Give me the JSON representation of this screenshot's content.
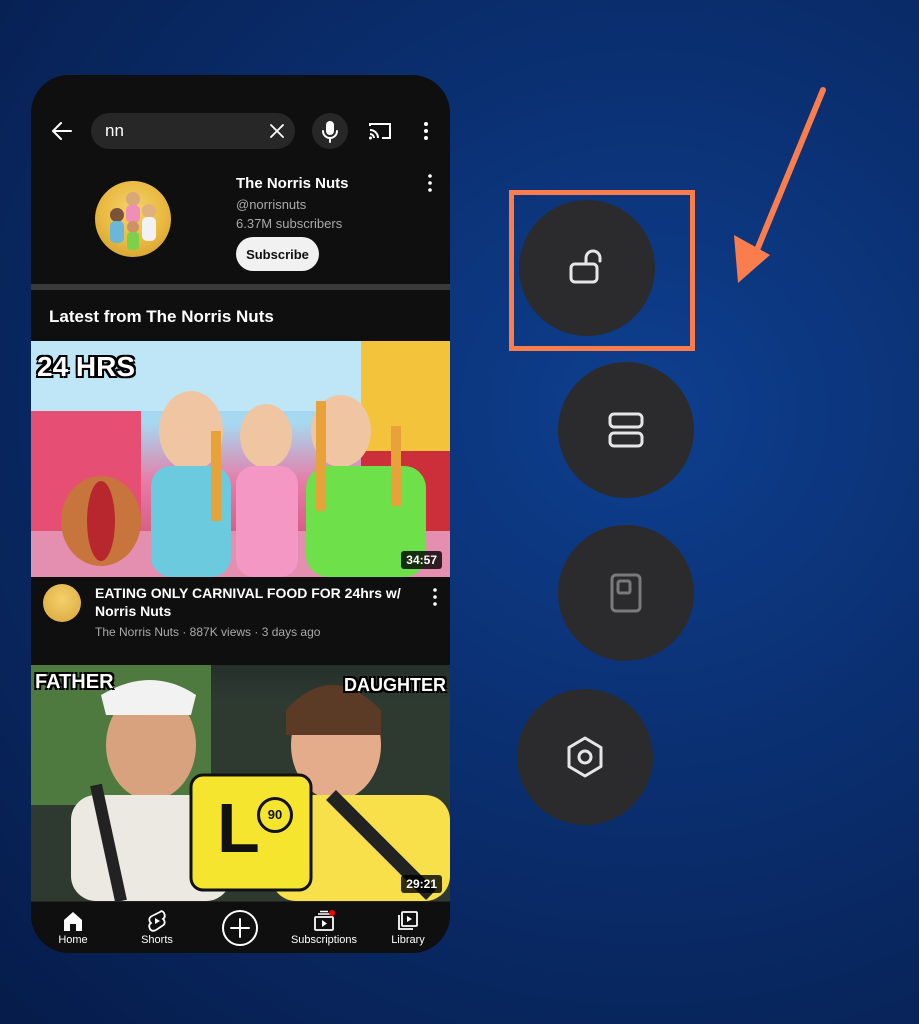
{
  "search": {
    "query": "nn"
  },
  "channel": {
    "name": "The Norris Nuts",
    "handle": "@norrisnuts",
    "subscribers": "6.37M subscribers",
    "subscribe_label": "Subscribe"
  },
  "section": {
    "title": "Latest from The Norris Nuts"
  },
  "videos": [
    {
      "title": "EATING ONLY CARNIVAL FOOD FOR 24hrs w/ Norris Nuts",
      "meta": "The Norris Nuts · 887K views · 3 days ago",
      "duration": "34:57",
      "thumb_text": "24 HRS"
    },
    {
      "duration": "29:21",
      "thumb_left": "FATHER",
      "thumb_right": "DAUGHTER",
      "sign_letter": "L",
      "sign_number": "90"
    }
  ],
  "nav": {
    "home": "Home",
    "shorts": "Shorts",
    "subscriptions": "Subscriptions",
    "library": "Library"
  },
  "colors": {
    "highlight": "#fb7d4e",
    "button_bg": "#2b2b2d",
    "background": "#0a2e6e"
  },
  "icons": [
    "back-icon",
    "clear-icon",
    "mic-icon",
    "cast-icon",
    "more-icon",
    "home-icon",
    "shorts-icon",
    "create-icon",
    "subscriptions-icon",
    "library-icon",
    "unlock-icon",
    "split-screen-icon",
    "pop-up-window-icon",
    "settings-icon"
  ]
}
